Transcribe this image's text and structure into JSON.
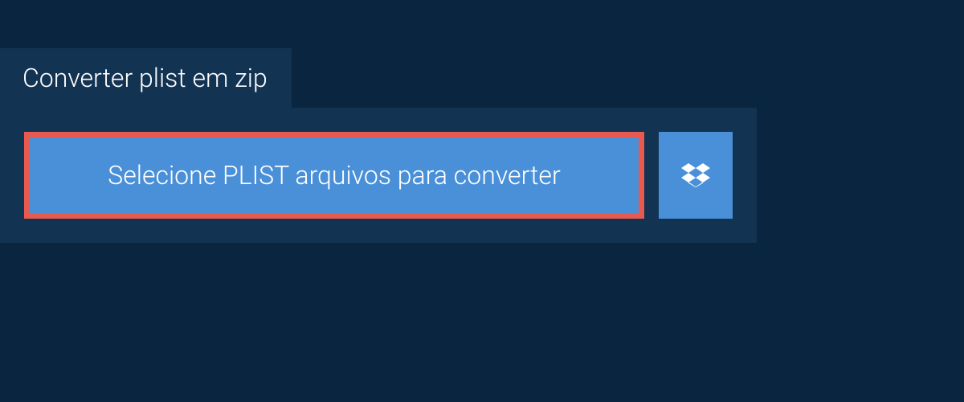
{
  "tab": {
    "title": "Converter plist em zip"
  },
  "upload": {
    "select_label": "Selecione PLIST arquivos para converter"
  },
  "colors": {
    "background": "#0a2540",
    "panel": "#133353",
    "button": "#4a90d9",
    "highlight_border": "#e85a4f",
    "text": "#ffffff"
  }
}
